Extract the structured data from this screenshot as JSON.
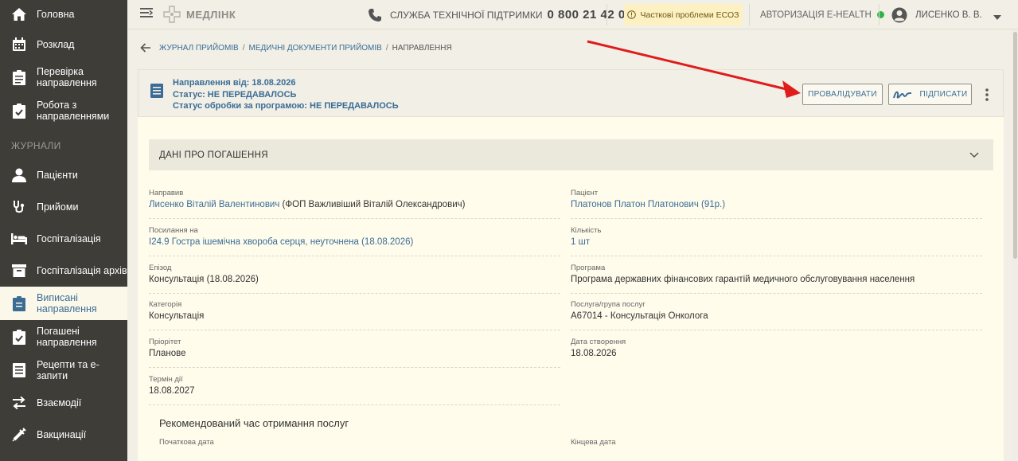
{
  "sidebar": {
    "section_label": "ЖУРНАЛИ",
    "items": [
      {
        "label": "Головна",
        "icon": "home-icon"
      },
      {
        "label": "Розклад",
        "icon": "calendar-icon"
      },
      {
        "label": "Перевірка направлення",
        "icon": "clipboard-icon"
      },
      {
        "label": "Робота з направленнями",
        "icon": "clipboard-check-icon"
      },
      {
        "label": "Пацієнти",
        "icon": "person-icon"
      },
      {
        "label": "Прийоми",
        "icon": "stethoscope-icon"
      },
      {
        "label": "Госпіталізація",
        "icon": "bed-icon"
      },
      {
        "label": "Госпіталізація архів",
        "icon": "archive-icon"
      },
      {
        "label": "Виписані направлення",
        "icon": "clipboard-list-icon",
        "active": true
      },
      {
        "label": "Погашені направлення",
        "icon": "clipboard-check-icon"
      },
      {
        "label": "Рецепти та е-запити",
        "icon": "list-icon"
      },
      {
        "label": "Взаємодії",
        "icon": "swap-icon"
      },
      {
        "label": "Вакцинації",
        "icon": "syringe-icon"
      }
    ]
  },
  "topbar": {
    "logo": "МЕДЛІНК",
    "support_label": "СЛУЖБА ТЕХНІЧНОЇ ПІДТРИМКИ",
    "support_phone": "0 800 21 42 00",
    "warning": "Часткові проблеми ЕСОЗ",
    "ehealth": "АВТОРИЗАЦІЯ E-HEALTH",
    "user": "ЛИСЕНКО В. В."
  },
  "breadcrumb": {
    "items": [
      "ЖУРНАЛ ПРИЙОМІВ",
      "МЕДИЧНІ ДОКУМЕНТИ ПРИЙОМІВ"
    ],
    "separator": "/",
    "current": "НАПРАВЛЕННЯ"
  },
  "header": {
    "line1": "Направлення від: 18.08.2026",
    "line2": "Статус: НЕ ПЕРЕДАВАЛОСЬ",
    "line3": "Статус обробки за програмою: НЕ ПЕРЕДАВАЛОСЬ",
    "validate_label": "ПРОВАЛІДУВАТИ",
    "sign_label": "ПІДПИСАТИ"
  },
  "section": {
    "title": "ДАНІ ПРО ПОГАШЕННЯ"
  },
  "fields": {
    "referrer": {
      "label": "Направив",
      "link": "Лисенко Віталій Валентинович",
      "extra": " (ФОП Важливіший Віталій Олександрович)"
    },
    "patient": {
      "label": "Пацієнт",
      "link": "Платонов Платон Платонович (91р.)"
    },
    "reference": {
      "label": "Посилання на",
      "link": "I24.9 Гостра ішемічна хвороба серця, неуточнена (18.08.2026)"
    },
    "quantity": {
      "label": "Кількість",
      "link": "1 шт"
    },
    "episode": {
      "label": "Епізод",
      "value": "Консультація (18.08.2026)"
    },
    "program": {
      "label": "Програма",
      "value": "Програма державних фінансових гарантій медичного обслуговування населення"
    },
    "category": {
      "label": "Категорія",
      "value": "Консультація"
    },
    "service": {
      "label": "Послуга/група послуг",
      "value": "A67014 - Консультація Онколога"
    },
    "priority": {
      "label": "Пріорітет",
      "value": "Планове"
    },
    "created": {
      "label": "Дата створення",
      "value": "18.08.2026"
    },
    "validity": {
      "label": "Термін дії",
      "value": "18.08.2027"
    }
  },
  "recommended": {
    "title": "Рекомендований час отримання послуг",
    "start_label": "Початкова дата",
    "end_label": "Кінцева дата"
  },
  "colors": {
    "sidebar_bg": "#3e3d38",
    "accent_blue": "#3a6c96",
    "warning_bg": "#fdf0c2",
    "status_green": "#35b34a",
    "annotation_arrow": "#e01b1b"
  }
}
